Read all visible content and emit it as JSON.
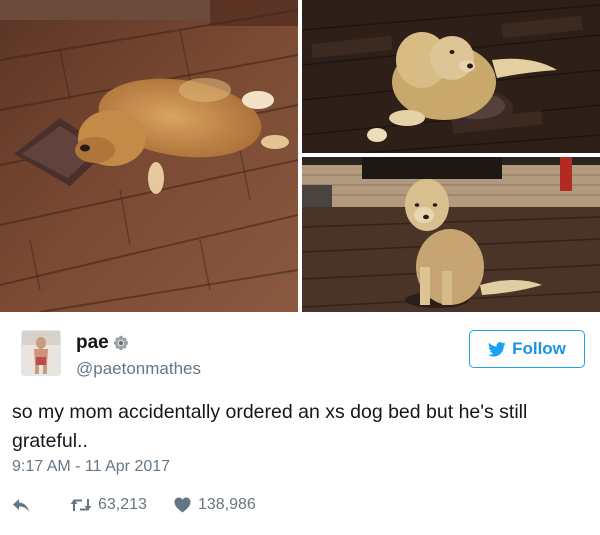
{
  "user": {
    "display_name": "pae",
    "handle": "@paetonmathes",
    "avatar_icon": "avatar-photo",
    "badge_icon": "flower-emoji-icon"
  },
  "follow_button": {
    "label": "Follow",
    "icon": "twitter-bird-icon",
    "color": "#1da1f2"
  },
  "tweet": {
    "text": "so my mom accidentally ordered an xs dog bed but he's still grateful..",
    "timestamp": "9:17 AM - 11 Apr 2017"
  },
  "stats": {
    "reply_icon": "reply-icon",
    "retweet_icon": "retweet-icon",
    "retweets": "63,213",
    "like_icon": "heart-icon",
    "likes": "138,986"
  },
  "photos": [
    {
      "id": "photo-dog-lying-on-small-bed"
    },
    {
      "id": "photo-dog-lying-top-right"
    },
    {
      "id": "photo-dog-sitting-bottom-right"
    }
  ]
}
